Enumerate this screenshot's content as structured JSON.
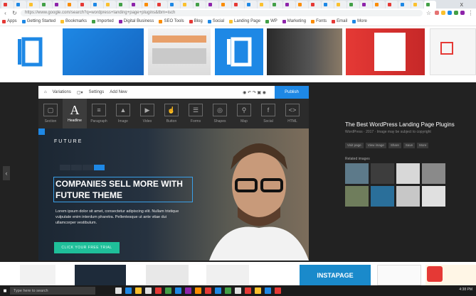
{
  "browser": {
    "tab_count": 34,
    "close_glyph": "x",
    "url_text": "https://www.google.com/search?q=wordpress+landing+page+plugins&tbm=isch",
    "bookmarks": [
      "Apps",
      "Getting Started",
      "Bookmarks",
      "Imported",
      "Digital Business",
      "SEO Tools",
      "Blog",
      "Social",
      "Landing Page",
      "WP",
      "Marketing",
      "Fonts",
      "Email",
      "More"
    ]
  },
  "editor": {
    "toolbar": {
      "website_label": "Variations",
      "settings_label": "Settings",
      "add_new_label": "Add New",
      "publish_label": "Publish"
    },
    "palette": [
      {
        "label": "Section",
        "icon": "section-icon",
        "glyph": "▢"
      },
      {
        "label": "Headline",
        "icon": "headline-icon",
        "glyph": "A"
      },
      {
        "label": "Paragraph",
        "icon": "paragraph-icon",
        "glyph": "≡"
      },
      {
        "label": "Image",
        "icon": "image-icon",
        "glyph": "▲"
      },
      {
        "label": "Video",
        "icon": "video-icon",
        "glyph": "▶"
      },
      {
        "label": "Button",
        "icon": "button-icon",
        "glyph": "☝"
      },
      {
        "label": "Forms",
        "icon": "forms-icon",
        "glyph": "☰"
      },
      {
        "label": "Shapes",
        "icon": "shapes-icon",
        "glyph": "◎"
      },
      {
        "label": "Map",
        "icon": "map-icon",
        "glyph": "⚲"
      },
      {
        "label": "Social",
        "icon": "social-icon",
        "glyph": "f"
      },
      {
        "label": "HTML",
        "icon": "html-icon",
        "glyph": "<>"
      }
    ],
    "hero": {
      "brand": "FUTURE",
      "headline_line1": "COMPANIES SELL MORE WITH",
      "headline_line2": "FUTURE THEME",
      "paragraph": "Lorem ipsum dolor sit amet, consectetur adipiscing elit. Nullam tristique vulputate enim interdum pharetra. Pellentesque ut ante vitae dui ullamcorper vestibulum.",
      "cta": "CLICK YOUR FREE TRIAL"
    }
  },
  "info": {
    "title": "The Best WordPress Landing Page Plugins",
    "meta": "WordPress · 2017 · Image may be subject to copyright",
    "buttons": [
      "Visit page",
      "View image",
      "Share",
      "Save",
      "More"
    ],
    "related_label": "Related images"
  },
  "bottom": {
    "instapage_label": "INSTAPAGE"
  },
  "taskbar": {
    "search_placeholder": "Type here to search",
    "clock": "4:38 PM"
  },
  "colors": {
    "brand_blue": "#1e88e5",
    "cta_green": "#1fbf9a",
    "preview_bg": "#222222"
  }
}
